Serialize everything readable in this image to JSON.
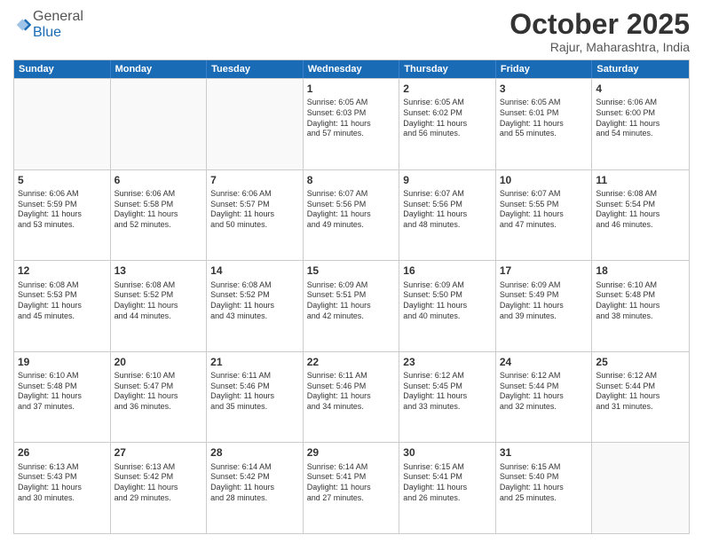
{
  "header": {
    "logo_general": "General",
    "logo_blue": "Blue",
    "month": "October 2025",
    "location": "Rajur, Maharashtra, India"
  },
  "weekdays": [
    "Sunday",
    "Monday",
    "Tuesday",
    "Wednesday",
    "Thursday",
    "Friday",
    "Saturday"
  ],
  "weeks": [
    [
      {
        "day": "",
        "info": ""
      },
      {
        "day": "",
        "info": ""
      },
      {
        "day": "",
        "info": ""
      },
      {
        "day": "1",
        "info": "Sunrise: 6:05 AM\nSunset: 6:03 PM\nDaylight: 11 hours\nand 57 minutes."
      },
      {
        "day": "2",
        "info": "Sunrise: 6:05 AM\nSunset: 6:02 PM\nDaylight: 11 hours\nand 56 minutes."
      },
      {
        "day": "3",
        "info": "Sunrise: 6:05 AM\nSunset: 6:01 PM\nDaylight: 11 hours\nand 55 minutes."
      },
      {
        "day": "4",
        "info": "Sunrise: 6:06 AM\nSunset: 6:00 PM\nDaylight: 11 hours\nand 54 minutes."
      }
    ],
    [
      {
        "day": "5",
        "info": "Sunrise: 6:06 AM\nSunset: 5:59 PM\nDaylight: 11 hours\nand 53 minutes."
      },
      {
        "day": "6",
        "info": "Sunrise: 6:06 AM\nSunset: 5:58 PM\nDaylight: 11 hours\nand 52 minutes."
      },
      {
        "day": "7",
        "info": "Sunrise: 6:06 AM\nSunset: 5:57 PM\nDaylight: 11 hours\nand 50 minutes."
      },
      {
        "day": "8",
        "info": "Sunrise: 6:07 AM\nSunset: 5:56 PM\nDaylight: 11 hours\nand 49 minutes."
      },
      {
        "day": "9",
        "info": "Sunrise: 6:07 AM\nSunset: 5:56 PM\nDaylight: 11 hours\nand 48 minutes."
      },
      {
        "day": "10",
        "info": "Sunrise: 6:07 AM\nSunset: 5:55 PM\nDaylight: 11 hours\nand 47 minutes."
      },
      {
        "day": "11",
        "info": "Sunrise: 6:08 AM\nSunset: 5:54 PM\nDaylight: 11 hours\nand 46 minutes."
      }
    ],
    [
      {
        "day": "12",
        "info": "Sunrise: 6:08 AM\nSunset: 5:53 PM\nDaylight: 11 hours\nand 45 minutes."
      },
      {
        "day": "13",
        "info": "Sunrise: 6:08 AM\nSunset: 5:52 PM\nDaylight: 11 hours\nand 44 minutes."
      },
      {
        "day": "14",
        "info": "Sunrise: 6:08 AM\nSunset: 5:52 PM\nDaylight: 11 hours\nand 43 minutes."
      },
      {
        "day": "15",
        "info": "Sunrise: 6:09 AM\nSunset: 5:51 PM\nDaylight: 11 hours\nand 42 minutes."
      },
      {
        "day": "16",
        "info": "Sunrise: 6:09 AM\nSunset: 5:50 PM\nDaylight: 11 hours\nand 40 minutes."
      },
      {
        "day": "17",
        "info": "Sunrise: 6:09 AM\nSunset: 5:49 PM\nDaylight: 11 hours\nand 39 minutes."
      },
      {
        "day": "18",
        "info": "Sunrise: 6:10 AM\nSunset: 5:48 PM\nDaylight: 11 hours\nand 38 minutes."
      }
    ],
    [
      {
        "day": "19",
        "info": "Sunrise: 6:10 AM\nSunset: 5:48 PM\nDaylight: 11 hours\nand 37 minutes."
      },
      {
        "day": "20",
        "info": "Sunrise: 6:10 AM\nSunset: 5:47 PM\nDaylight: 11 hours\nand 36 minutes."
      },
      {
        "day": "21",
        "info": "Sunrise: 6:11 AM\nSunset: 5:46 PM\nDaylight: 11 hours\nand 35 minutes."
      },
      {
        "day": "22",
        "info": "Sunrise: 6:11 AM\nSunset: 5:46 PM\nDaylight: 11 hours\nand 34 minutes."
      },
      {
        "day": "23",
        "info": "Sunrise: 6:12 AM\nSunset: 5:45 PM\nDaylight: 11 hours\nand 33 minutes."
      },
      {
        "day": "24",
        "info": "Sunrise: 6:12 AM\nSunset: 5:44 PM\nDaylight: 11 hours\nand 32 minutes."
      },
      {
        "day": "25",
        "info": "Sunrise: 6:12 AM\nSunset: 5:44 PM\nDaylight: 11 hours\nand 31 minutes."
      }
    ],
    [
      {
        "day": "26",
        "info": "Sunrise: 6:13 AM\nSunset: 5:43 PM\nDaylight: 11 hours\nand 30 minutes."
      },
      {
        "day": "27",
        "info": "Sunrise: 6:13 AM\nSunset: 5:42 PM\nDaylight: 11 hours\nand 29 minutes."
      },
      {
        "day": "28",
        "info": "Sunrise: 6:14 AM\nSunset: 5:42 PM\nDaylight: 11 hours\nand 28 minutes."
      },
      {
        "day": "29",
        "info": "Sunrise: 6:14 AM\nSunset: 5:41 PM\nDaylight: 11 hours\nand 27 minutes."
      },
      {
        "day": "30",
        "info": "Sunrise: 6:15 AM\nSunset: 5:41 PM\nDaylight: 11 hours\nand 26 minutes."
      },
      {
        "day": "31",
        "info": "Sunrise: 6:15 AM\nSunset: 5:40 PM\nDaylight: 11 hours\nand 25 minutes."
      },
      {
        "day": "",
        "info": ""
      }
    ]
  ]
}
